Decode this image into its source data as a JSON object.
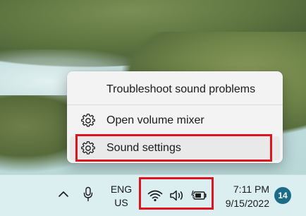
{
  "context_menu": {
    "items": [
      {
        "label": "Troubleshoot sound problems",
        "icon": "none"
      },
      {
        "label": "Open volume mixer",
        "icon": "gear-icon"
      },
      {
        "label": "Sound settings",
        "icon": "gear-icon",
        "highlighted": true
      }
    ]
  },
  "taskbar": {
    "show_hidden_icons": "chevron-up-icon",
    "microphone": "microphone-icon",
    "language": {
      "line1": "ENG",
      "line2": "US"
    },
    "tray_icons": [
      "wifi-icon",
      "speaker-icon",
      "battery-charging-icon"
    ],
    "clock": {
      "time": "7:11 PM",
      "date": "9/15/2022"
    },
    "notification_count": "14"
  },
  "colors": {
    "highlight_box": "#e0141e",
    "badge": "#1b6c86",
    "menu_background": "#f3f3f3",
    "taskbar_background": "#dbeef0"
  }
}
